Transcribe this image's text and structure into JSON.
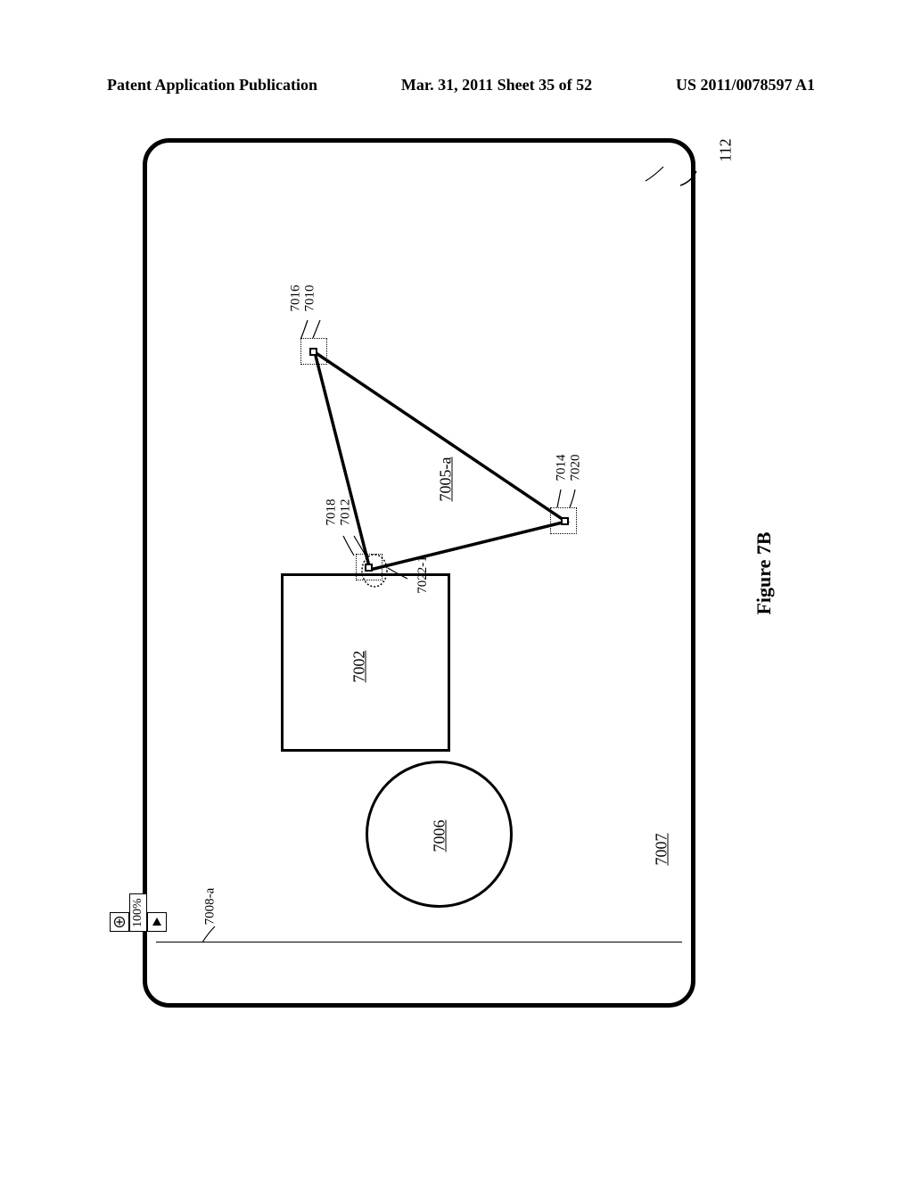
{
  "header": {
    "left": "Patent Application Publication",
    "center": "Mar. 31, 2011  Sheet 35 of 52",
    "right": "US 2011/0078597 A1"
  },
  "figure": {
    "caption": "Figure 7B",
    "device_ref": "112"
  },
  "toolbar": {
    "zoom_ref": "7008-a",
    "zoom_value": "100%"
  },
  "shapes": {
    "square_ref": "7002",
    "circle_ref": "7006",
    "triangle_ref": "7005-a",
    "canvas_ref": "7007"
  },
  "vertices": {
    "v1_handle": "7010",
    "v1_region": "7016",
    "v2_handle": "7012",
    "v2_region": "7018",
    "v3_handle": "7014",
    "v3_region": "7020",
    "touch": "7022-1"
  }
}
